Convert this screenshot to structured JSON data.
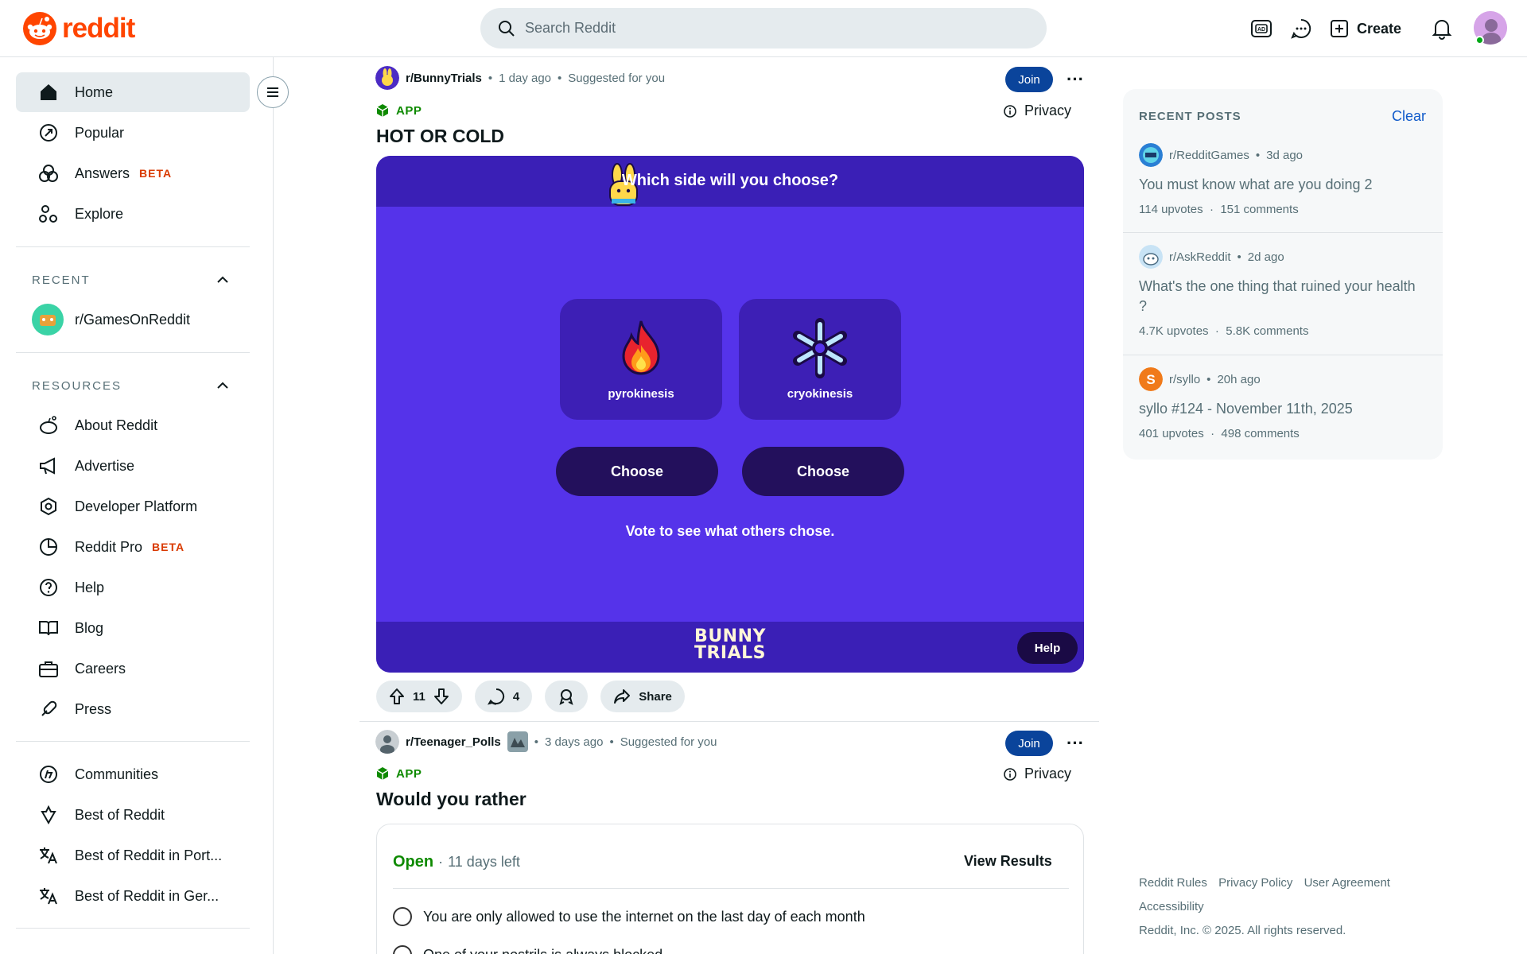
{
  "header": {
    "logo_text": "reddit",
    "search_placeholder": "Search Reddit",
    "create_label": "Create",
    "brand_color": "#ff4500"
  },
  "sidebar": {
    "nav": [
      {
        "label": "Home",
        "icon": "home-icon",
        "active": true
      },
      {
        "label": "Popular",
        "icon": "popular-icon"
      },
      {
        "label": "Answers",
        "icon": "answers-icon",
        "badge": "BETA"
      },
      {
        "label": "Explore",
        "icon": "explore-icon"
      }
    ],
    "recent_title": "RECENT",
    "recent": [
      {
        "label": "r/GamesOnReddit"
      }
    ],
    "resources_title": "RESOURCES",
    "resources": [
      {
        "label": "About Reddit",
        "icon": "reddit-alien-icon"
      },
      {
        "label": "Advertise",
        "icon": "megaphone-icon"
      },
      {
        "label": "Developer Platform",
        "icon": "developer-icon"
      },
      {
        "label": "Reddit Pro",
        "icon": "reddit-pro-icon",
        "badge": "BETA"
      },
      {
        "label": "Help",
        "icon": "help-icon"
      },
      {
        "label": "Blog",
        "icon": "book-icon"
      },
      {
        "label": "Careers",
        "icon": "briefcase-icon"
      },
      {
        "label": "Press",
        "icon": "link-icon"
      }
    ],
    "more": [
      {
        "label": "Communities",
        "icon": "communities-icon"
      },
      {
        "label": "Best of Reddit",
        "icon": "best-icon"
      },
      {
        "label": "Best of Reddit in Port...",
        "icon": "translate-icon"
      },
      {
        "label": "Best of Reddit in Ger...",
        "icon": "translate-icon"
      }
    ]
  },
  "posts": [
    {
      "subreddit": "r/BunnyTrials",
      "time": "1 day ago",
      "suggested": "Suggested for you",
      "join_label": "Join",
      "app_label": "APP",
      "privacy_label": "Privacy",
      "title": "HOT OR COLD",
      "game": {
        "question": "Which side will you choose?",
        "options": [
          {
            "label": "pyrokinesis",
            "icon": "fire-icon"
          },
          {
            "label": "cryokinesis",
            "icon": "snowflake-icon"
          }
        ],
        "choose_label": "Choose",
        "note": "Vote to see what others chose.",
        "brand_line1": "BUNNY",
        "brand_line2": "TRIALS",
        "help_label": "Help",
        "colors": {
          "bg": "#5533ea",
          "bar": "#3a1fb6",
          "button": "#23105c"
        }
      },
      "votes": "11",
      "comments": "4",
      "share_label": "Share"
    },
    {
      "subreddit": "r/Teenager_Polls",
      "time": "3 days ago",
      "suggested": "Suggested for you",
      "join_label": "Join",
      "app_label": "APP",
      "privacy_label": "Privacy",
      "title": "Would you rather",
      "poll": {
        "status": "Open",
        "time_left": "11 days left",
        "view_results": "View Results",
        "options": [
          "You are only allowed to use the internet on the last day of each month",
          "One of your nostrils is always blocked"
        ]
      }
    }
  ],
  "recent_posts": {
    "title": "RECENT POSTS",
    "clear_label": "Clear",
    "items": [
      {
        "subreddit": "r/RedditGames",
        "time": "3d ago",
        "title": "You must know what are you doing 2",
        "upvotes": "114 upvotes",
        "comments": "151 comments"
      },
      {
        "subreddit": "r/AskReddit",
        "time": "2d ago",
        "title": "What's the one thing that ruined your health ?",
        "upvotes": "4.7K upvotes",
        "comments": "5.8K comments"
      },
      {
        "subreddit": "r/syllo",
        "time": "20h ago",
        "title": "syllo #124 - November 11th, 2025",
        "upvotes": "401 upvotes",
        "comments": "498 comments"
      }
    ]
  },
  "footer": {
    "links": [
      "Reddit Rules",
      "Privacy Policy",
      "User Agreement",
      "Accessibility"
    ],
    "copyright": "Reddit, Inc. © 2025. All rights reserved."
  }
}
